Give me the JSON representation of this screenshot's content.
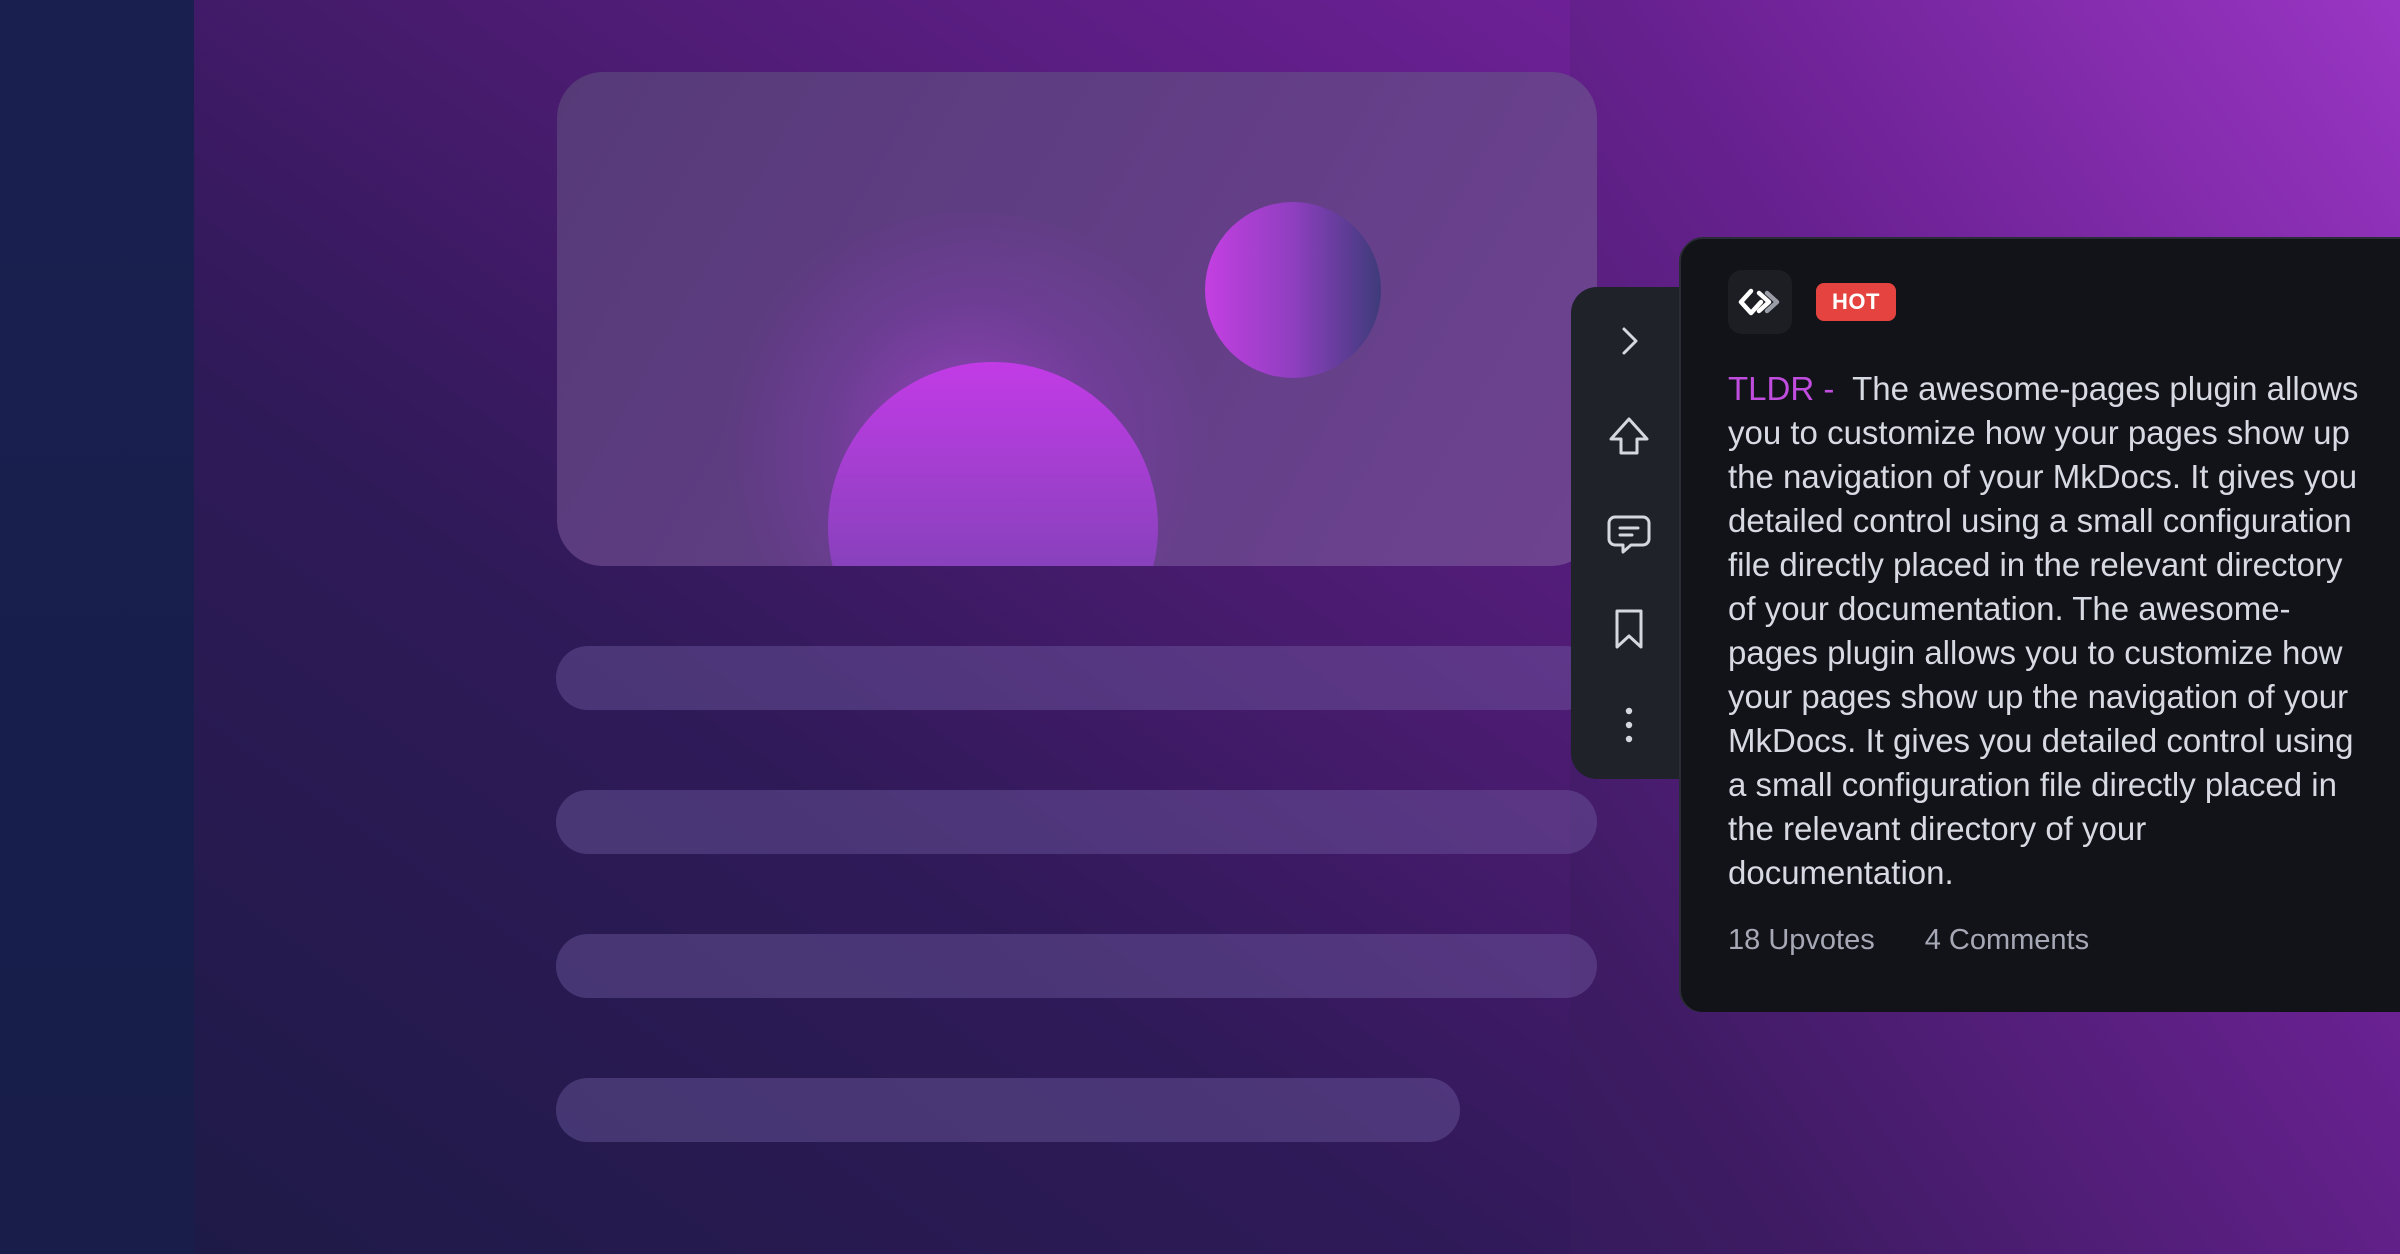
{
  "colors": {
    "accent_tldr": "#c14dde",
    "hot_badge": "#e4433f",
    "card_bg": "#111318",
    "rail_bg": "#20222a"
  },
  "action_rail": {
    "items": [
      {
        "icon": "chevron-right-icon"
      },
      {
        "icon": "upvote-arrow-icon"
      },
      {
        "icon": "comment-icon"
      },
      {
        "icon": "bookmark-icon"
      },
      {
        "icon": "more-vertical-icon"
      }
    ]
  },
  "post": {
    "logo_icon": "daily-dev-logo-icon",
    "badge": "HOT",
    "tldr_label": "TLDR -",
    "text": "The awesome-pages plugin allows you to customize how your pages show up the navigation of your MkDocs. It gives you detailed control using a small configuration file directly placed in the relevant directory of your documentation. The awesome-pages plugin allows you to customize how your pages show up the navigation of your MkDocs. It gives you detailed control using a small configuration file directly placed in the relevant directory of your documentation.",
    "upvotes": "18 Upvotes",
    "comments": "4 Comments"
  }
}
